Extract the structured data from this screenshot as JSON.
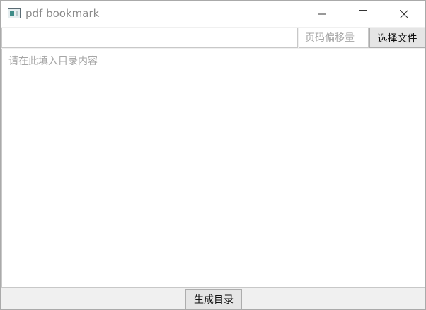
{
  "window": {
    "title": "pdf bookmark"
  },
  "toolbar": {
    "path_value": "",
    "offset_placeholder": "页码偏移量",
    "choose_file_label": "选择文件"
  },
  "content": {
    "placeholder": "请在此填入目录内容",
    "value": ""
  },
  "footer": {
    "generate_label": "生成目录"
  },
  "colors": {
    "titlebar_bg": "#ffffff",
    "toolbar_bg": "#f0f0f0",
    "button_bg": "#e5e5e5",
    "placeholder_text": "#a6a6a6"
  },
  "icons": {
    "app": "app-window-icon",
    "minimize": "minimize-icon",
    "maximize": "maximize-icon",
    "close": "close-icon"
  }
}
